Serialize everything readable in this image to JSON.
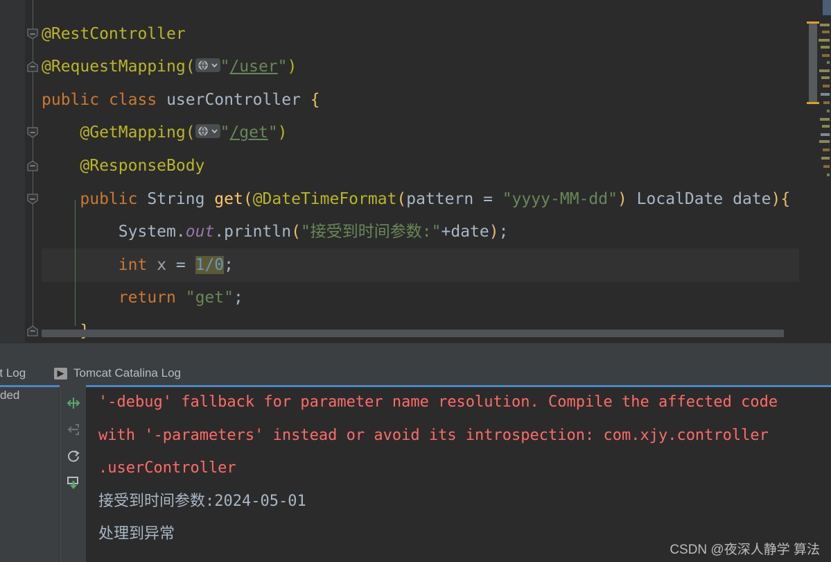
{
  "editor": {
    "language": "java",
    "lines": [
      {
        "indent": 0,
        "fold": "none",
        "tokens": []
      },
      {
        "indent": 0,
        "fold": "collapse-down",
        "tokens": [
          {
            "t": "anno",
            "v": "@RestController"
          }
        ]
      },
      {
        "indent": 0,
        "fold": "collapse-up",
        "tokens": [
          {
            "t": "anno",
            "v": "@RequestMapping("
          },
          {
            "t": "globe",
            "v": "globe-icon"
          },
          {
            "t": "str",
            "v": "\""
          },
          {
            "t": "strlink",
            "v": "/user"
          },
          {
            "t": "str",
            "v": "\""
          },
          {
            "t": "anno",
            "v": ")"
          }
        ]
      },
      {
        "indent": 0,
        "fold": "none",
        "tokens": [
          {
            "t": "kw",
            "v": "public"
          },
          {
            "t": "plain",
            "v": " "
          },
          {
            "t": "kw",
            "v": "class"
          },
          {
            "t": "plain",
            "v": " "
          },
          {
            "t": "cls",
            "v": "userController"
          },
          {
            "t": "plain",
            "v": " "
          },
          {
            "t": "brace",
            "v": "{"
          }
        ]
      },
      {
        "indent": 1,
        "fold": "collapse-down",
        "tokens": [
          {
            "t": "anno",
            "v": "@GetMapping("
          },
          {
            "t": "globe",
            "v": "globe-icon"
          },
          {
            "t": "str",
            "v": "\""
          },
          {
            "t": "strlink",
            "v": "/get"
          },
          {
            "t": "str",
            "v": "\""
          },
          {
            "t": "anno",
            "v": ")"
          }
        ]
      },
      {
        "indent": 1,
        "fold": "collapse-up",
        "tokens": [
          {
            "t": "anno",
            "v": "@ResponseBody"
          }
        ]
      },
      {
        "indent": 1,
        "fold": "collapse-down",
        "tokens": [
          {
            "t": "kw",
            "v": "public"
          },
          {
            "t": "plain",
            "v": " "
          },
          {
            "t": "cls",
            "v": "String"
          },
          {
            "t": "plain",
            "v": " "
          },
          {
            "t": "meth",
            "v": "get"
          },
          {
            "t": "paren",
            "v": "("
          },
          {
            "t": "anno",
            "v": "@DateTimeFormat"
          },
          {
            "t": "paren",
            "v": "("
          },
          {
            "t": "ident",
            "v": "pattern"
          },
          {
            "t": "plain",
            "v": " = "
          },
          {
            "t": "str",
            "v": "\"yyyy-MM-dd\""
          },
          {
            "t": "paren",
            "v": ")"
          },
          {
            "t": "plain",
            "v": " "
          },
          {
            "t": "cls",
            "v": "LocalDate"
          },
          {
            "t": "plain",
            "v": " "
          },
          {
            "t": "ident",
            "v": "date"
          },
          {
            "t": "paren",
            "v": ")"
          },
          {
            "t": "brace",
            "v": "{"
          }
        ]
      },
      {
        "indent": 2,
        "fold": "none",
        "tokens": [
          {
            "t": "cls",
            "v": "System"
          },
          {
            "t": "plain",
            "v": "."
          },
          {
            "t": "field",
            "v": "out"
          },
          {
            "t": "plain",
            "v": "."
          },
          {
            "t": "ident",
            "v": "println"
          },
          {
            "t": "paren",
            "v": "("
          },
          {
            "t": "str",
            "v": "\"接受到时间参数:\""
          },
          {
            "t": "plain",
            "v": "+"
          },
          {
            "t": "ident",
            "v": "date"
          },
          {
            "t": "paren",
            "v": ")"
          },
          {
            "t": "plain",
            "v": ";"
          }
        ]
      },
      {
        "indent": 2,
        "fold": "none",
        "highlighted": true,
        "tokens": [
          {
            "t": "kw",
            "v": "int"
          },
          {
            "t": "plain",
            "v": " "
          },
          {
            "t": "dim",
            "v": "x"
          },
          {
            "t": "plain",
            "v": " = "
          },
          {
            "t": "hlnum",
            "v": "1/0"
          },
          {
            "t": "plain",
            "v": ";"
          }
        ]
      },
      {
        "indent": 2,
        "fold": "none",
        "tokens": [
          {
            "t": "kw",
            "v": "return"
          },
          {
            "t": "plain",
            "v": " "
          },
          {
            "t": "str",
            "v": "\"get\""
          },
          {
            "t": "plain",
            "v": ";"
          }
        ]
      },
      {
        "indent": 1,
        "fold": "collapse-up",
        "tokens": [
          {
            "t": "brace",
            "v": "}"
          }
        ]
      }
    ],
    "highlight_value": "1/0",
    "scrollbar": {
      "vertical_label": "editor-vertical-scrollbar",
      "horizontal_label": "editor-horizontal-scrollbar"
    }
  },
  "console": {
    "tabs": [
      {
        "label": "host Log",
        "icon": null,
        "selected": false,
        "truncated": true
      },
      {
        "label": "Tomcat Catalina Log",
        "icon": "console-run-icon",
        "selected": true,
        "truncated": false
      }
    ],
    "left_panel_text": "ded",
    "toolbar": [
      {
        "name": "soft-wrap-icon",
        "title": "Use Soft Wraps",
        "active": true
      },
      {
        "name": "scroll-to-source-icon",
        "title": "Scroll to Source",
        "active": false
      },
      {
        "name": "rerun-icon",
        "title": "Rerun",
        "active": false
      },
      {
        "name": "scroll-to-end-icon",
        "title": "Scroll to the End",
        "active": true
      }
    ],
    "output": [
      {
        "type": "error",
        "text": "'-debug' fallback for parameter name resolution. Compile the affected code"
      },
      {
        "type": "error",
        "text": "with '-parameters' instead or avoid its introspection: com.xjy.controller"
      },
      {
        "type": "error",
        "text": ".userController"
      },
      {
        "type": "stdout",
        "text": "接受到时间参数:2024-05-01"
      },
      {
        "type": "stdout",
        "text": "处理到异常"
      }
    ]
  },
  "watermark": {
    "text": "CSDN @夜深人静学 算法"
  },
  "colors": {
    "editor_bg": "#2b2b2b",
    "gutter_bg": "#313335",
    "panel_bg": "#3c3f41",
    "annotation": "#bbb529",
    "keyword": "#cc7832",
    "string": "#6a8759",
    "number": "#6897bb",
    "field": "#9876aa",
    "paren": "#e8bf6a",
    "default_text": "#a9b7c6",
    "error_text": "#ff6b68",
    "tab_accent": "#4a88c7",
    "highlight_bg": "#5c5a34",
    "icon_green": "#59a869"
  }
}
